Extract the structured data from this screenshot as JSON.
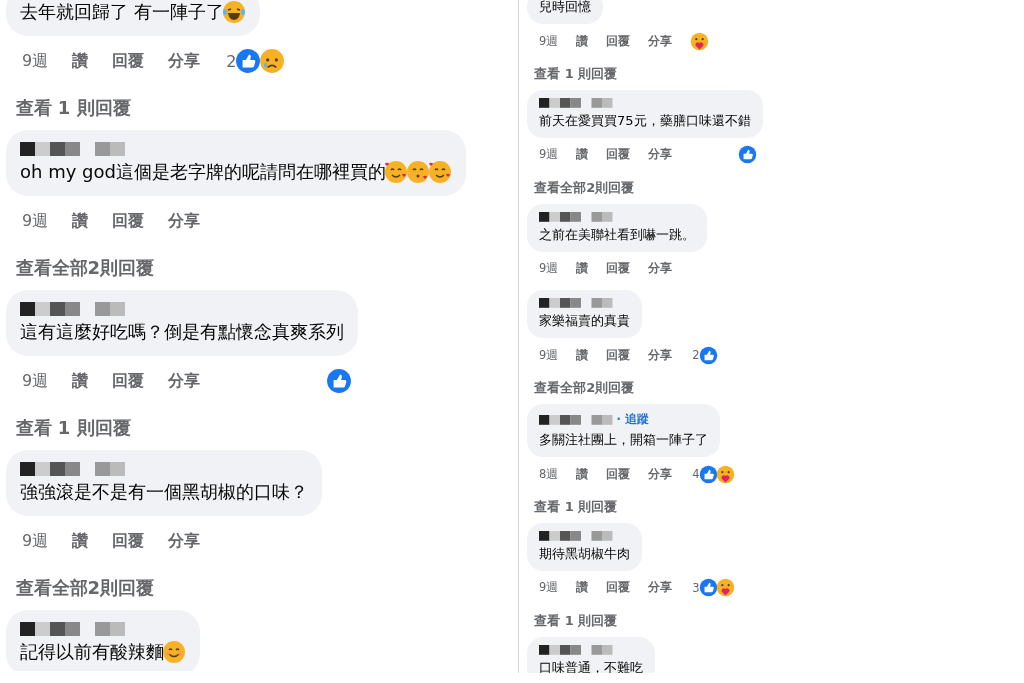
{
  "panels": [
    {
      "comments": [
        {
          "text": "去年就回歸了 有一陣子了",
          "emojis": [
            {
              "kind": "laugh"
            }
          ],
          "actions": {
            "time": "9週",
            "like": "讚",
            "reply": "回覆",
            "share": "分享"
          },
          "reactions": {
            "count": "2",
            "icons": [
              {
                "kind": "like"
              },
              {
                "kind": "sad"
              }
            ]
          },
          "replies_link": "查看 1 則回覆"
        },
        {
          "name_blurred": true,
          "text": "oh my god這個是老字牌的呢請問在哪裡買的",
          "emojis": [
            {
              "kind": "hearts"
            },
            {
              "kind": "kiss"
            },
            {
              "kind": "hearts"
            }
          ],
          "actions": {
            "time": "9週",
            "like": "讚",
            "reply": "回覆",
            "share": "分享"
          },
          "replies_link": "查看全部2則回覆"
        },
        {
          "name_blurred": true,
          "text": "這有這麼好吃嗎？倒是有點懷念真爽系列",
          "actions": {
            "time": "9週",
            "like": "讚",
            "reply": "回覆",
            "share": "分享"
          },
          "reactions": {
            "icons": [
              {
                "kind": "like"
              }
            ]
          },
          "replies_link": "查看 1 則回覆"
        },
        {
          "name_blurred": true,
          "text": "強強滾是不是有一個黑胡椒的口味？",
          "actions": {
            "time": "9週",
            "like": "讚",
            "reply": "回覆",
            "share": "分享"
          },
          "replies_link": "查看全部2則回覆"
        },
        {
          "name_blurred": true,
          "text": "記得以前有酸辣麵",
          "emojis": [
            {
              "kind": "smile"
            }
          ]
        }
      ]
    },
    {
      "comments": [
        {
          "text": "兒時回憶",
          "actions": {
            "time": "9週",
            "like": "讚",
            "reply": "回覆",
            "share": "分享"
          },
          "reactions": {
            "icons": [
              {
                "kind": "care"
              }
            ]
          },
          "replies_link": "查看 1 則回覆"
        },
        {
          "name_blurred": true,
          "text": "前天在愛買買75元，藥膳口味還不錯",
          "actions": {
            "time": "9週",
            "like": "讚",
            "reply": "回覆",
            "share": "分享"
          },
          "reactions": {
            "icons": [
              {
                "kind": "like"
              }
            ]
          },
          "replies_link": "查看全部2則回覆"
        },
        {
          "name_blurred": true,
          "text": "之前在美聯社看到嚇一跳。",
          "actions": {
            "time": "9週",
            "like": "讚",
            "reply": "回覆",
            "share": "分享"
          }
        },
        {
          "name_blurred": true,
          "text": "家樂福賣的真貴",
          "actions": {
            "time": "9週",
            "like": "讚",
            "reply": "回覆",
            "share": "分享"
          },
          "reactions": {
            "count": "2",
            "icons": [
              {
                "kind": "like"
              }
            ]
          },
          "replies_link": "查看全部2則回覆"
        },
        {
          "name_blurred": true,
          "follow": "· 追蹤",
          "text": "多關注社團上，開箱一陣子了",
          "actions": {
            "time": "8週",
            "like": "讚",
            "reply": "回覆",
            "share": "分享"
          },
          "reactions": {
            "count": "4",
            "icons": [
              {
                "kind": "like"
              },
              {
                "kind": "care"
              }
            ]
          },
          "replies_link": "查看 1 則回覆"
        },
        {
          "name_blurred": true,
          "text": "期待黑胡椒牛肉",
          "actions": {
            "time": "9週",
            "like": "讚",
            "reply": "回覆",
            "share": "分享"
          },
          "reactions": {
            "count": "3",
            "icons": [
              {
                "kind": "like"
              },
              {
                "kind": "care"
              }
            ]
          },
          "replies_link": "查看 1 則回覆"
        },
        {
          "name_blurred": true,
          "text": "口味普通，不難吃"
        }
      ]
    }
  ]
}
